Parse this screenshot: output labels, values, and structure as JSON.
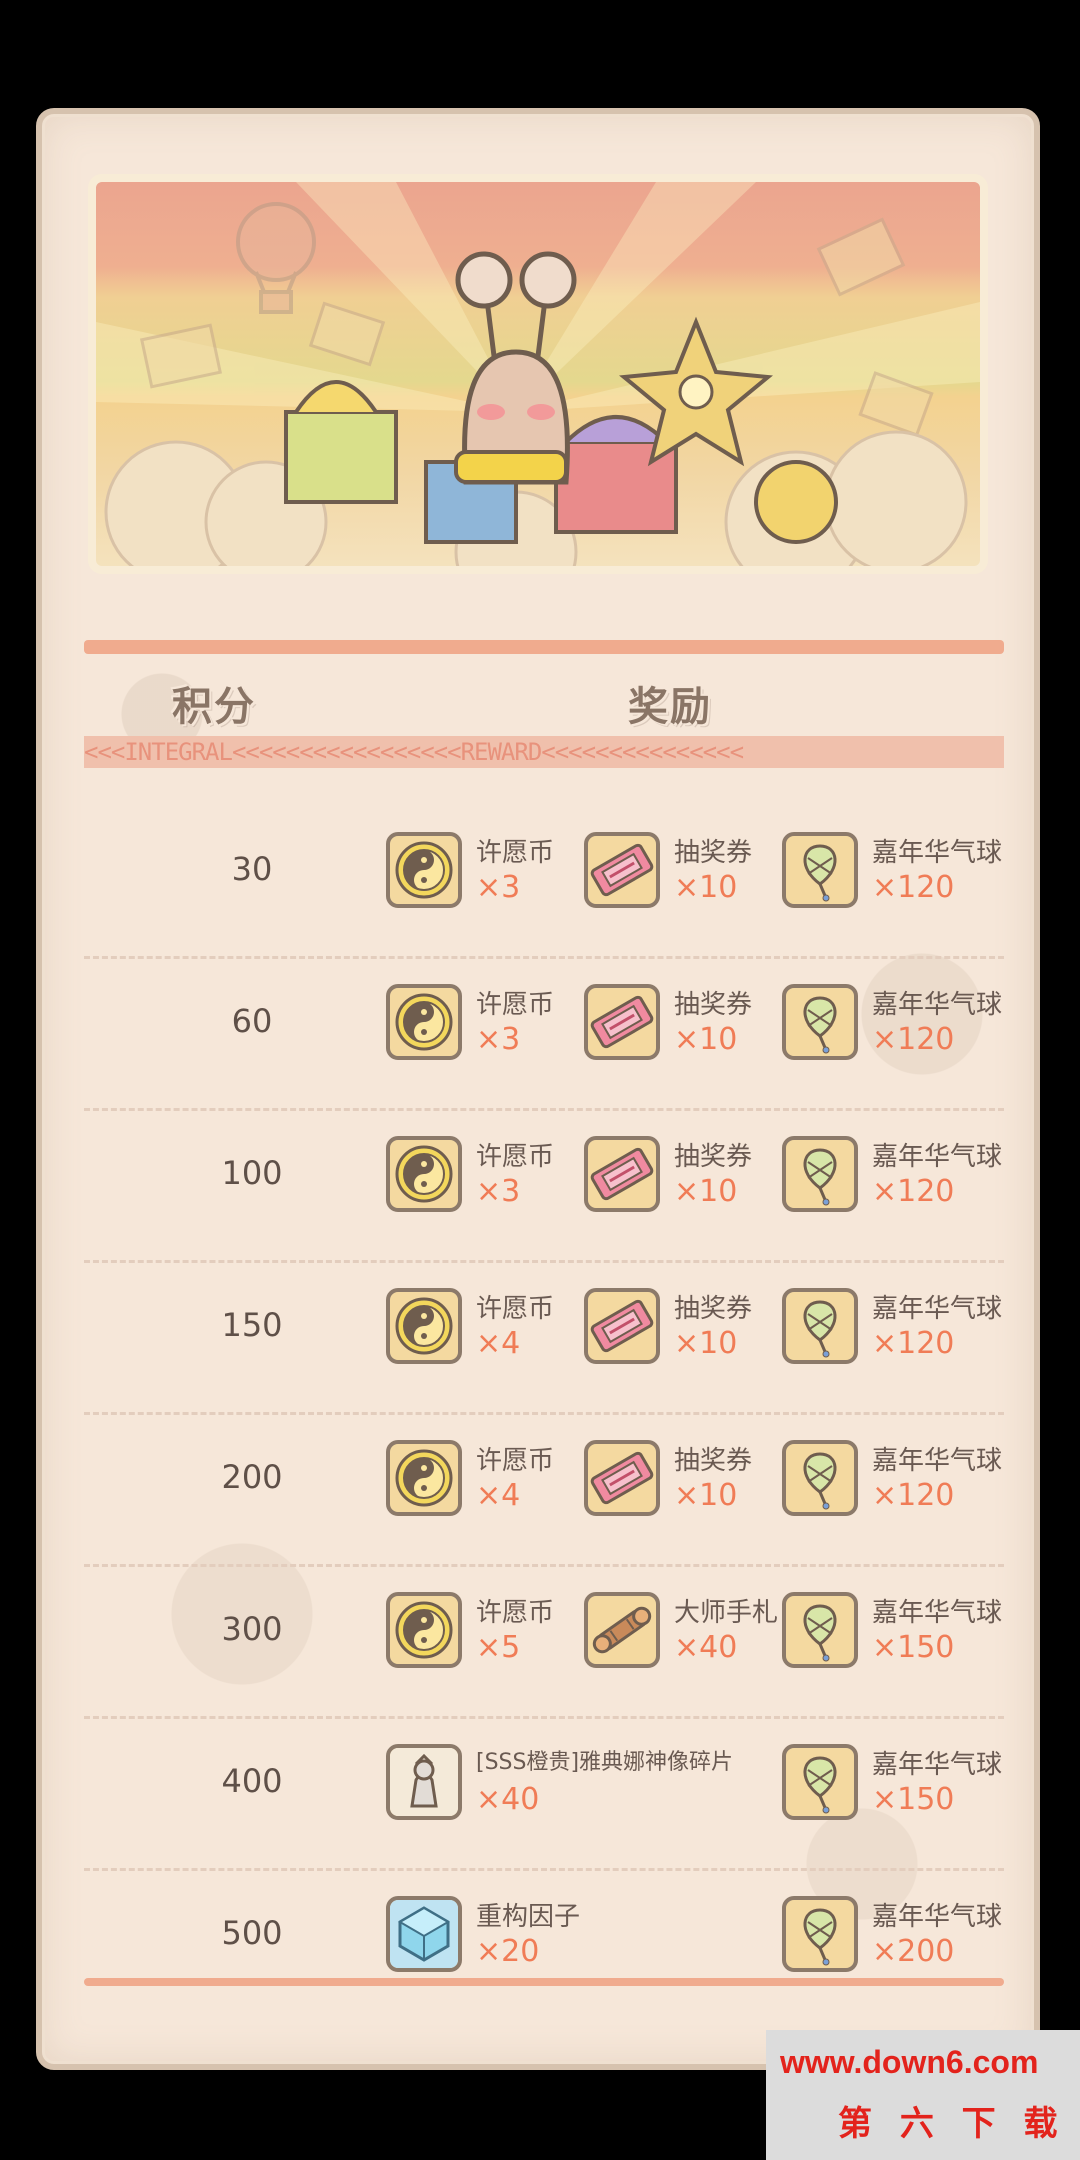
{
  "header": {
    "score_label": "积分",
    "reward_label": "奖励",
    "subheader": "<<<INTEGRAL<<<<<<<<<<<<<<<<<REWARD<<<<<<<<<<<<<<<"
  },
  "rows": [
    {
      "score": "30",
      "rewards": [
        {
          "icon": "wish-coin-icon",
          "name": "许愿币",
          "qty": "×3"
        },
        {
          "icon": "lottery-ticket-icon",
          "name": "抽奖券",
          "qty": "×10"
        },
        {
          "icon": "carnival-balloon-icon",
          "name": "嘉年华气球",
          "qty": "×120"
        }
      ]
    },
    {
      "score": "60",
      "rewards": [
        {
          "icon": "wish-coin-icon",
          "name": "许愿币",
          "qty": "×3"
        },
        {
          "icon": "lottery-ticket-icon",
          "name": "抽奖券",
          "qty": "×10"
        },
        {
          "icon": "carnival-balloon-icon",
          "name": "嘉年华气球",
          "qty": "×120"
        }
      ]
    },
    {
      "score": "100",
      "rewards": [
        {
          "icon": "wish-coin-icon",
          "name": "许愿币",
          "qty": "×3"
        },
        {
          "icon": "lottery-ticket-icon",
          "name": "抽奖券",
          "qty": "×10"
        },
        {
          "icon": "carnival-balloon-icon",
          "name": "嘉年华气球",
          "qty": "×120"
        }
      ]
    },
    {
      "score": "150",
      "rewards": [
        {
          "icon": "wish-coin-icon",
          "name": "许愿币",
          "qty": "×4"
        },
        {
          "icon": "lottery-ticket-icon",
          "name": "抽奖券",
          "qty": "×10"
        },
        {
          "icon": "carnival-balloon-icon",
          "name": "嘉年华气球",
          "qty": "×120"
        }
      ]
    },
    {
      "score": "200",
      "rewards": [
        {
          "icon": "wish-coin-icon",
          "name": "许愿币",
          "qty": "×4"
        },
        {
          "icon": "lottery-ticket-icon",
          "name": "抽奖券",
          "qty": "×10"
        },
        {
          "icon": "carnival-balloon-icon",
          "name": "嘉年华气球",
          "qty": "×120"
        }
      ]
    },
    {
      "score": "300",
      "rewards": [
        {
          "icon": "wish-coin-icon",
          "name": "许愿币",
          "qty": "×5"
        },
        {
          "icon": "master-scroll-icon",
          "name": "大师手札",
          "qty": "×40"
        },
        {
          "icon": "carnival-balloon-icon",
          "name": "嘉年华气球",
          "qty": "×150"
        }
      ]
    },
    {
      "score": "400",
      "rewards": [
        {
          "icon": "statue-fragment-icon",
          "name": "[SSS橙贵]雅典娜神像碎片",
          "qty": "×40"
        },
        {
          "icon": "carnival-balloon-icon",
          "name": "嘉年华气球",
          "qty": "×150"
        }
      ]
    },
    {
      "score": "500",
      "rewards": [
        {
          "icon": "rebuild-factor-icon",
          "name": "重构因子",
          "qty": "×20"
        },
        {
          "icon": "carnival-balloon-icon",
          "name": "嘉年华气球",
          "qty": "×200"
        }
      ]
    }
  ],
  "watermark": {
    "url": "www.down6.com",
    "name": "第 六 下 载"
  },
  "colors": {
    "panel_bg": "#f6e7d9",
    "accent_rule": "#f0ab8e",
    "quantity_text": "#f07c56",
    "icon_frame_fill": "#f4d9a0"
  }
}
